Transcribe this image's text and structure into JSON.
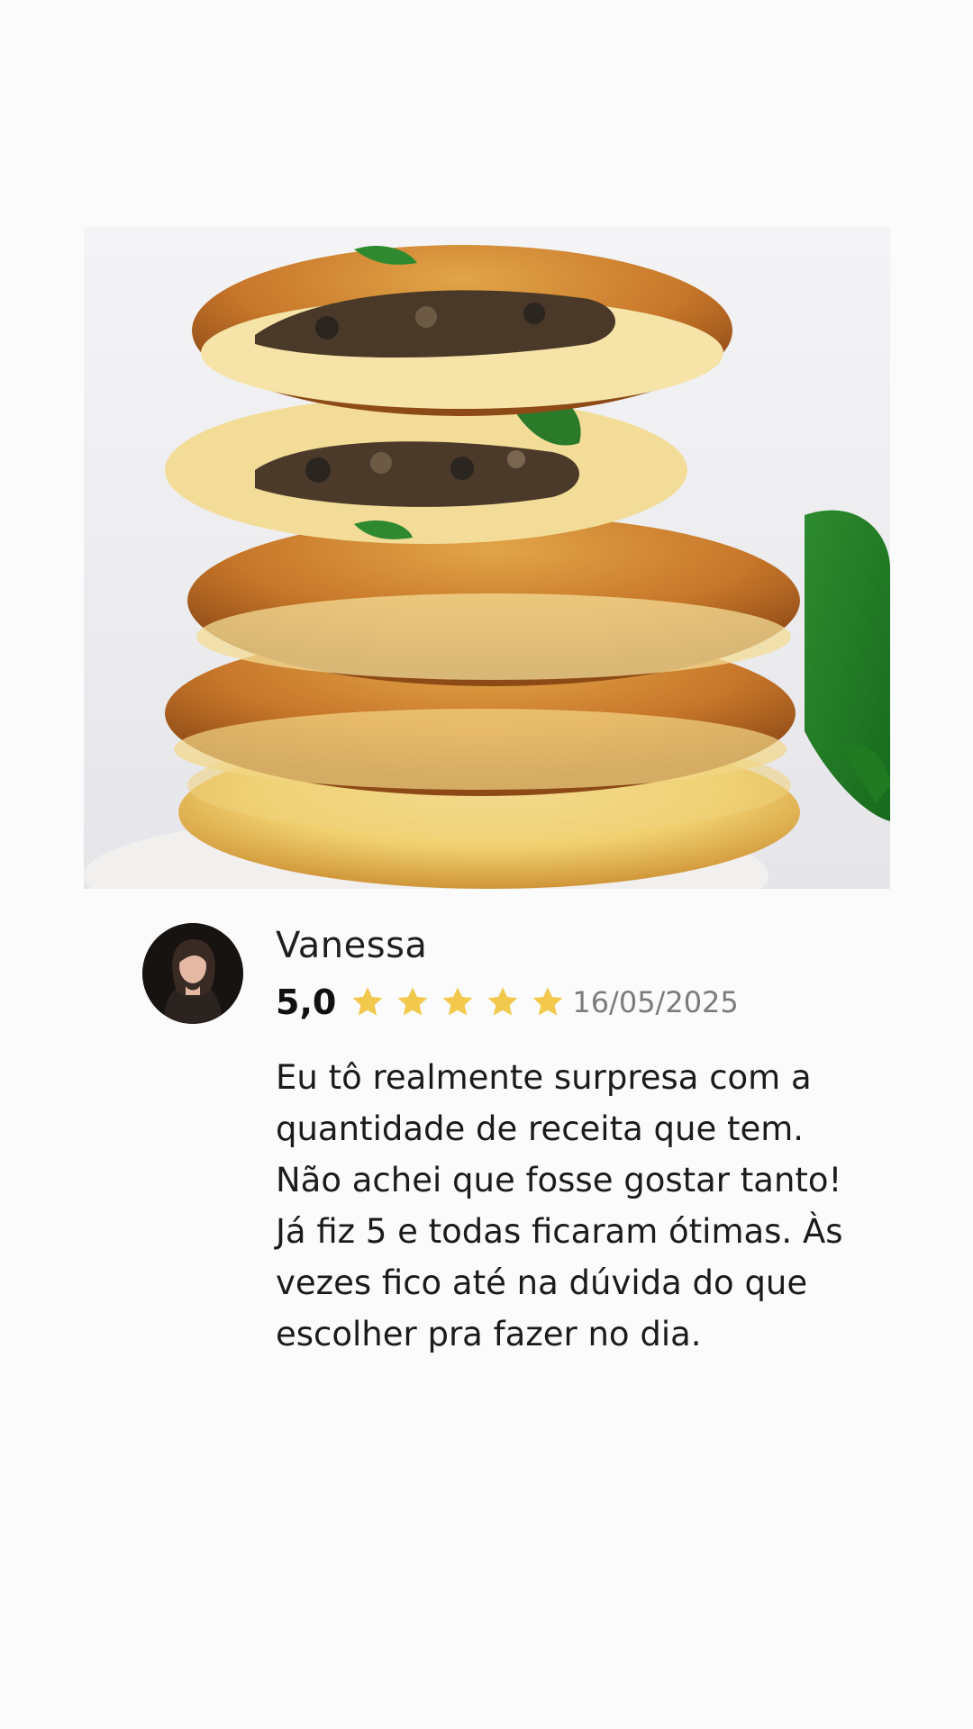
{
  "photo": {
    "alt_icon": "food-photo"
  },
  "review": {
    "author": "Vanessa",
    "rating": "5,0",
    "stars": 5,
    "date": "16/05/2025",
    "text": "Eu tô realmente surpresa com a quantidade de receita que tem. Não achei que fosse gostar tanto! Já fiz 5 e todas ficaram ótimas. Às vezes fico até na dúvida do que escolher pra fazer no dia."
  },
  "colors": {
    "background": "#fbfbfc",
    "star": "#f2c94c",
    "date": "#7b7b7b"
  }
}
